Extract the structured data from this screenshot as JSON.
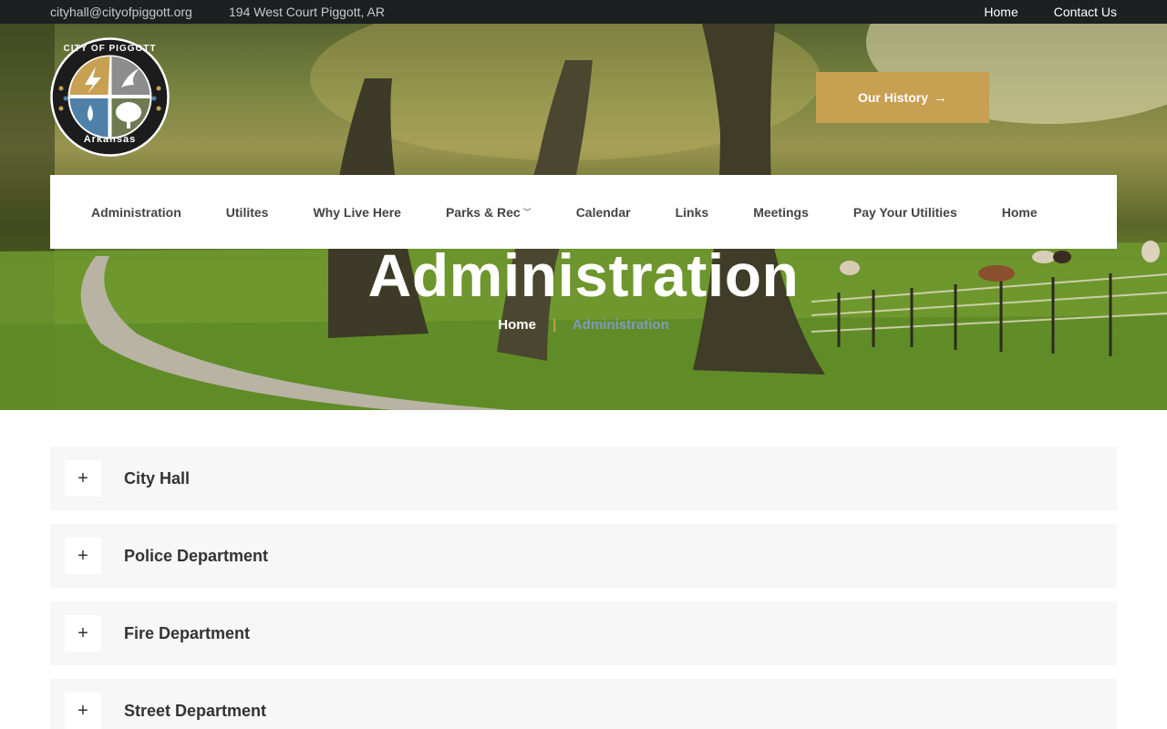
{
  "topbar": {
    "email": "cityhall@cityofpiggott.org",
    "address": "194 West Court Piggott, AR",
    "links": [
      "Home",
      "Contact Us"
    ]
  },
  "logo": {
    "top_text": "CITY OF PIGGOTT",
    "bottom_text": "Arkansas"
  },
  "hero": {
    "history_button": "Our History",
    "title": "Administration",
    "breadcrumb": {
      "home": "Home",
      "separator": "|",
      "current": "Administration"
    }
  },
  "nav": {
    "items": [
      "Administration",
      "Utilites",
      "Why Live Here",
      "Parks & Rec",
      "Calendar",
      "Links",
      "Meetings",
      "Pay Your Utilities",
      "Home"
    ]
  },
  "accordion": {
    "toggle_symbol": "+",
    "items": [
      "City Hall",
      "Police Department",
      "Fire Department",
      "Street Department"
    ]
  },
  "colors": {
    "accent_gold": "#c8a052",
    "topbar_bg": "#1d1f20",
    "breadcrumb_current": "#7f9bbd",
    "accordion_bg": "#f7f7f7"
  }
}
